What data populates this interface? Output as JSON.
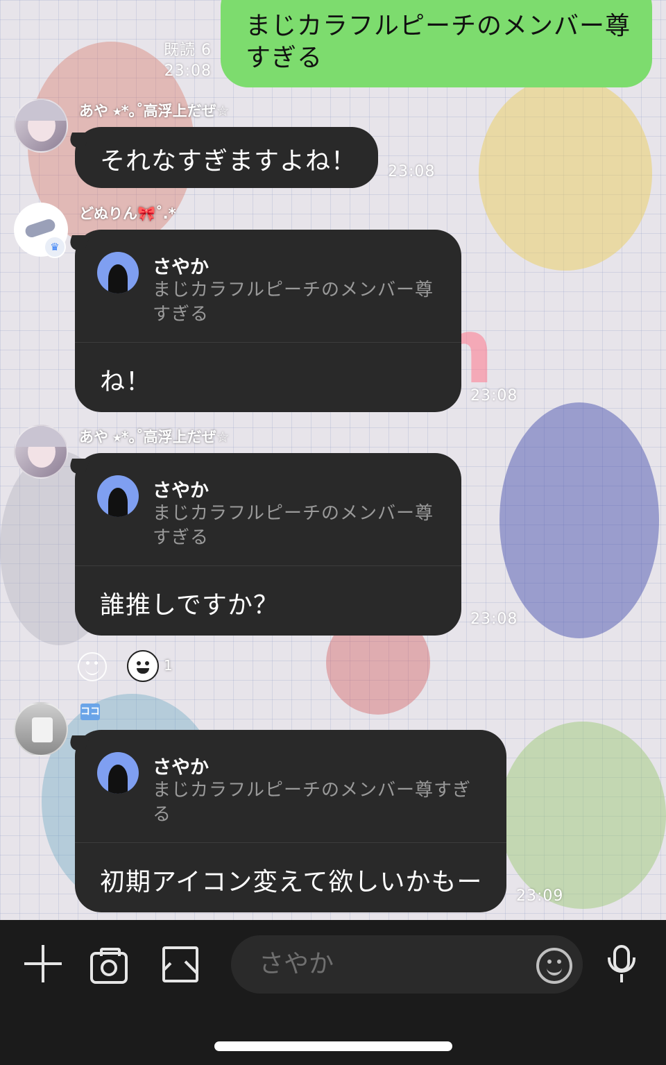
{
  "messages": {
    "m1": {
      "text_line1": "まじカラフルピーチのメンバー尊",
      "text_line2": "すぎる",
      "read": "既読 6",
      "time": "23:08"
    },
    "m2": {
      "sender": "あや ⭑*｡˚高浮上だぜ☆",
      "text": "それなすぎますよね！",
      "time": "23:08"
    },
    "m3": {
      "sender": "どぬりん🎀˚.*",
      "reply_name": "さやか",
      "reply_line1": "まじカラフルピーチのメンバー尊",
      "reply_line2": "すぎる",
      "text": "ね！",
      "time": "23:08"
    },
    "m4": {
      "sender": "あや ⭑*｡˚高浮上だぜ☆",
      "reply_name": "さやか",
      "reply_line1": "まじカラフルピーチのメンバー尊",
      "reply_line2": "すぎる",
      "text": "誰推しですか？",
      "time": "23:08",
      "reaction_count": "1"
    },
    "m5": {
      "badge": "ココ",
      "reply_name": "さやか",
      "reply_line1": "まじカラフルピーチのメンバー尊すぎ",
      "reply_line2": "る",
      "text": "初期アイコン変えて欲しいかもー",
      "time": "23:09"
    }
  },
  "input": {
    "placeholder": "さやか"
  },
  "icons": {
    "plus": "plus-icon",
    "camera": "camera-icon",
    "image": "image-icon",
    "emoji": "emoji-icon",
    "mic": "mic-icon",
    "add_reaction": "add-reaction-icon"
  },
  "colors": {
    "own_bubble": "#7ddc6e",
    "dark_bubble": "#292929",
    "input_bar": "#1b1b1b"
  }
}
